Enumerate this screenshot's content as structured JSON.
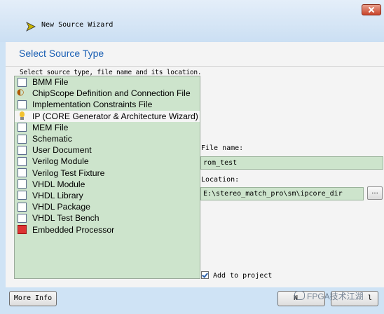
{
  "window": {
    "title": "New Source Wizard"
  },
  "page": {
    "heading": "Select Source Type",
    "instructions": "Select source type, file name and its location."
  },
  "source_types": [
    {
      "label": "BMM File",
      "icon": "bmm-file-icon"
    },
    {
      "label": "ChipScope Definition and Connection File",
      "icon": "chipscope-icon"
    },
    {
      "label": "Implementation Constraints File",
      "icon": "constraints-file-icon"
    },
    {
      "label": "IP (CORE Generator & Architecture Wizard)",
      "icon": "ip-core-icon"
    },
    {
      "label": "MEM File",
      "icon": "mem-file-icon"
    },
    {
      "label": "Schematic",
      "icon": "schematic-icon"
    },
    {
      "label": "User Document",
      "icon": "user-document-icon"
    },
    {
      "label": "Verilog Module",
      "icon": "verilog-module-icon"
    },
    {
      "label": "Verilog Test Fixture",
      "icon": "verilog-test-fixture-icon"
    },
    {
      "label": "VHDL Module",
      "icon": "vhdl-module-icon"
    },
    {
      "label": "VHDL Library",
      "icon": "vhdl-library-icon"
    },
    {
      "label": "VHDL Package",
      "icon": "vhdl-package-icon"
    },
    {
      "label": "VHDL Test Bench",
      "icon": "vhdl-test-bench-icon"
    },
    {
      "label": "Embedded Processor",
      "icon": "embedded-processor-icon"
    }
  ],
  "selected_index": 3,
  "form": {
    "file_name_label": "File name:",
    "file_name_value": "rom_test",
    "location_label": "Location:",
    "location_value": "E:\\stereo_match_pro\\sm\\ipcore_dir",
    "browse_label": "...",
    "add_to_project_label": "Add to project",
    "add_to_project_checked": true
  },
  "footer": {
    "more_info_label": "More Info",
    "next_label": "N",
    "cancel_label": "l"
  },
  "watermark": "FPGA技术江湖",
  "colors": {
    "accent": "#1a5fb4",
    "list_bg": "#cde4cc"
  }
}
